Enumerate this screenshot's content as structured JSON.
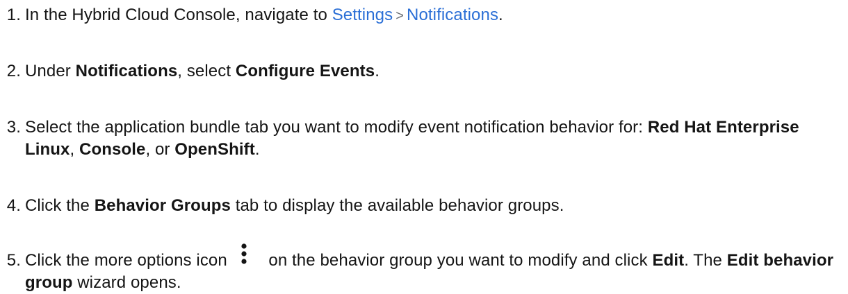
{
  "steps": [
    {
      "num": "1.",
      "t1": "In the Hybrid Cloud Console, navigate to ",
      "link1": "Settings",
      "sep": ">",
      "link2": "Notifications",
      "t2": "."
    },
    {
      "num": "2.",
      "t1": "Under ",
      "b1": "Notifications",
      "t2": ", select ",
      "b2": "Configure Events",
      "t3": "."
    },
    {
      "num": "3.",
      "t1": "Select the application bundle tab you want to modify event notification behavior for: ",
      "b1": "Red Hat Enterprise Linux",
      "t2": ", ",
      "b2": "Console",
      "t3": ", or ",
      "b3": "OpenShift",
      "t4": "."
    },
    {
      "num": "4.",
      "t1": "Click the ",
      "b1": "Behavior Groups",
      "t2": " tab to display the available behavior groups."
    },
    {
      "num": "5.",
      "t1": "Click the more options icon ",
      "icon": "kebab-vertical-icon",
      "t2": " on the behavior group you want to modify and click ",
      "b1": "Edit",
      "t3": ". The ",
      "b2": "Edit behavior group",
      "t4": " wizard opens."
    }
  ]
}
